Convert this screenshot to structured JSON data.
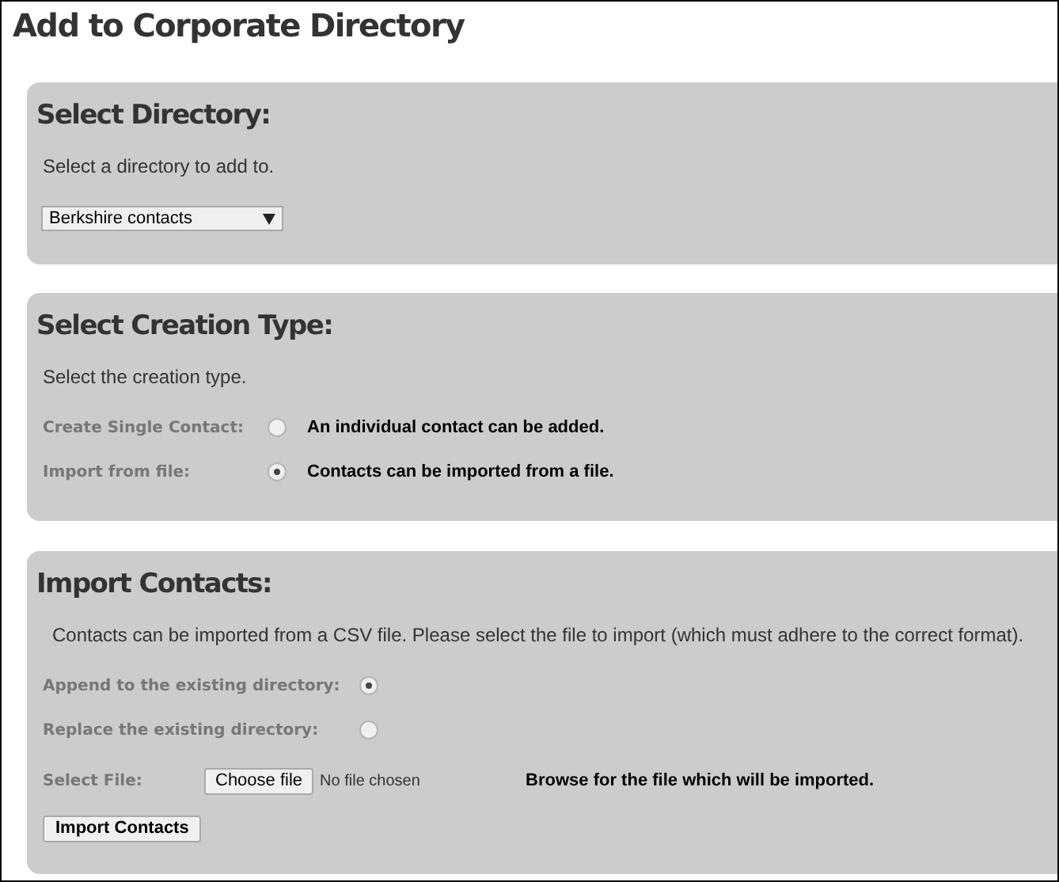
{
  "title": "Add to Corporate Directory",
  "directory": {
    "heading": "Select Directory:",
    "description": "Select a directory to add to.",
    "dropdown": {
      "value": "Berkshire contacts"
    }
  },
  "creation_type": {
    "heading": "Select Creation Type:",
    "description": "Select the creation type.",
    "options": [
      {
        "label": "Create Single Contact:",
        "description": "An individual contact can be added.",
        "selected": false
      },
      {
        "label": "Import from file:",
        "description": "Contacts can be imported from a file.",
        "selected": true
      }
    ]
  },
  "import": {
    "heading": "Import Contacts:",
    "description": "Contacts can be imported from a CSV file. Please select the file to import (which must adhere to the correct format).",
    "modes": [
      {
        "label": "Append to the existing directory:",
        "selected": true
      },
      {
        "label": "Replace the existing directory:",
        "selected": false
      }
    ],
    "file": {
      "label": "Select File:",
      "button": "Choose file",
      "status": "No file chosen",
      "hint": "Browse for the file which will be imported."
    },
    "submit": "Import Contacts"
  }
}
